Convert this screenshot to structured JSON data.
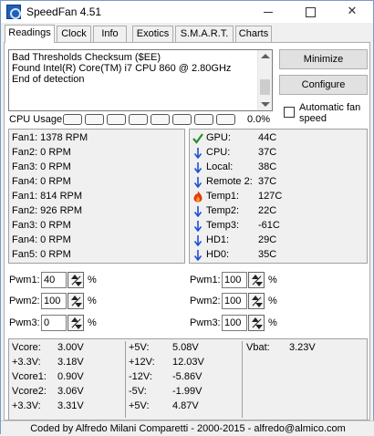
{
  "window": {
    "title": "SpeedFan 4.51",
    "controls": [
      "minimize-icon",
      "maximize-icon",
      "close-icon"
    ]
  },
  "tabs": [
    {
      "label": "Readings",
      "active": true
    },
    {
      "label": "Clock",
      "active": false
    },
    {
      "label": "Info",
      "active": false
    },
    {
      "label": "Exotics",
      "active": false
    },
    {
      "label": "S.M.A.R.T.",
      "active": false
    },
    {
      "label": "Charts",
      "active": false
    }
  ],
  "log": {
    "lines": [
      "Bad Thresholds Checksum ($EE)",
      "Found Intel(R) Core(TM) i7 CPU 860 @ 2.80GHz",
      "End of detection"
    ]
  },
  "buttons": {
    "minimize": "Minimize",
    "configure": "Configure"
  },
  "auto_fan_speed": {
    "label": "Automatic fan speed",
    "checked": false
  },
  "cpu_usage": {
    "label": "CPU Usage",
    "bar_count": 8,
    "percent": "0.0%"
  },
  "fans": [
    {
      "text": "Fan1: 1378 RPM"
    },
    {
      "text": "Fan2: 0 RPM"
    },
    {
      "text": "Fan3: 0 RPM"
    },
    {
      "text": "Fan4: 0 RPM"
    },
    {
      "text": "Fan1: 814 RPM"
    },
    {
      "text": "Fan2: 926 RPM"
    },
    {
      "text": "Fan3: 0 RPM"
    },
    {
      "text": "Fan4: 0 RPM"
    },
    {
      "text": "Fan5: 0 RPM"
    }
  ],
  "temps": [
    {
      "label": "GPU:",
      "value": "44C",
      "icon": "check-icon"
    },
    {
      "label": "CPU:",
      "value": "37C",
      "icon": "down-arrow-icon"
    },
    {
      "label": "Local:",
      "value": "38C",
      "icon": "down-arrow-icon"
    },
    {
      "label": "Remote 2:",
      "value": "37C",
      "icon": "down-arrow-icon"
    },
    {
      "label": "Temp1:",
      "value": "127C",
      "icon": "flame-icon"
    },
    {
      "label": "Temp2:",
      "value": "22C",
      "icon": "down-arrow-icon"
    },
    {
      "label": "Temp3:",
      "value": "-61C",
      "icon": "down-arrow-icon"
    },
    {
      "label": "HD1:",
      "value": "29C",
      "icon": "down-arrow-icon"
    },
    {
      "label": "HD0:",
      "value": "35C",
      "icon": "down-arrow-icon"
    }
  ],
  "pwm_left": [
    {
      "label": "Pwm1:",
      "value": "40",
      "unit": "%"
    },
    {
      "label": "Pwm2:",
      "value": "100",
      "unit": "%"
    },
    {
      "label": "Pwm3:",
      "value": "0",
      "unit": "%"
    }
  ],
  "pwm_right": [
    {
      "label": "Pwm1:",
      "value": "100",
      "unit": "%"
    },
    {
      "label": "Pwm2:",
      "value": "100",
      "unit": "%"
    },
    {
      "label": "Pwm3:",
      "value": "100",
      "unit": "%"
    }
  ],
  "voltages_col1": [
    {
      "label": "Vcore:",
      "value": "3.00V"
    },
    {
      "label": "+3.3V:",
      "value": "3.18V"
    },
    {
      "label": "Vcore1:",
      "value": "0.90V"
    },
    {
      "label": "Vcore2:",
      "value": "3.06V"
    },
    {
      "label": "+3.3V:",
      "value": "3.31V"
    }
  ],
  "voltages_col2": [
    {
      "label": "+5V:",
      "value": "5.08V"
    },
    {
      "label": "+12V:",
      "value": "12.03V"
    },
    {
      "label": "-12V:",
      "value": "-5.86V"
    },
    {
      "label": "-5V:",
      "value": "-1.99V"
    },
    {
      "label": "+5V:",
      "value": "4.87V"
    }
  ],
  "voltages_col3": [
    {
      "label": "Vbat:",
      "value": "3.23V"
    }
  ],
  "footer": "Coded by Alfredo Milani Comparetti - 2000-2015 - alfredo@almico.com",
  "colors": {
    "check_green": "#2e8b2e",
    "arrow_blue": "#1f4fd6",
    "flame_red": "#e03a10",
    "flame_orange": "#ff9a1a"
  }
}
